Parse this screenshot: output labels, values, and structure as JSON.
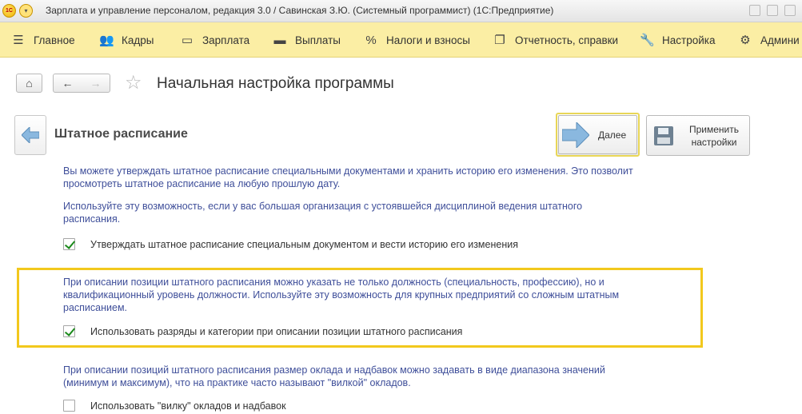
{
  "window": {
    "title": "Зарплата и управление персоналом, редакция 3.0 / Савинская З.Ю. (Системный программист)  (1С:Предприятие)",
    "logo_text": "1С"
  },
  "sections": [
    {
      "label": "Главное",
      "icon": "menu-icon"
    },
    {
      "label": "Кадры",
      "icon": "people-icon"
    },
    {
      "label": "Зарплата",
      "icon": "wallet-icon"
    },
    {
      "label": "Выплаты",
      "icon": "cash-icon"
    },
    {
      "label": "Налоги и взносы",
      "icon": "percent-icon"
    },
    {
      "label": "Отчетность, справки",
      "icon": "documents-icon"
    },
    {
      "label": "Настройка",
      "icon": "wrench-icon"
    },
    {
      "label": "Админи",
      "icon": "gear-icon"
    }
  ],
  "page": {
    "title": "Начальная настройка программы"
  },
  "step": {
    "title": "Штатное расписание",
    "next_label": "Далее",
    "apply_label_1": "Применить",
    "apply_label_2": "настройки"
  },
  "content": {
    "para1_line1": "Вы можете утверждать штатное расписание специальными документами и хранить историю его изменения. Это позволит",
    "para1_line2": "просмотреть штатное расписание на любую прошлую дату.",
    "para2_line1": "Используйте эту возможность, если у вас большая организация с устоявшейся дисциплиной ведения штатного",
    "para2_line2": "расписания.",
    "check1_label": "Утверждать штатное расписание специальным документом и вести историю его изменения",
    "check1_checked": true,
    "para3_line1": "При описании позиции штатного расписания можно указать не только должность (специальность, профессию), но и",
    "para3_line2": "квалификационный уровень должности. Используйте эту возможность для крупных предприятий со сложным штатным",
    "para3_line3": "расписанием.",
    "check2_label": "Использовать разряды и категории при описании позиции штатного расписания",
    "check2_checked": true,
    "para4_line1": "При описании позиций штатного расписания размер оклада и надбавок можно задавать в виде диапазона значений",
    "para4_line2": "(минимум и максимум), что на практике часто называют \"вилкой\" окладов.",
    "check3_label": "Использовать \"вилку\" окладов и надбавок",
    "check3_checked": false
  },
  "colors": {
    "section_bar": "#fbeea4",
    "highlight_border": "#f2c81d",
    "info_text": "#3f4f9a",
    "checkmark": "#1b8a1b"
  }
}
